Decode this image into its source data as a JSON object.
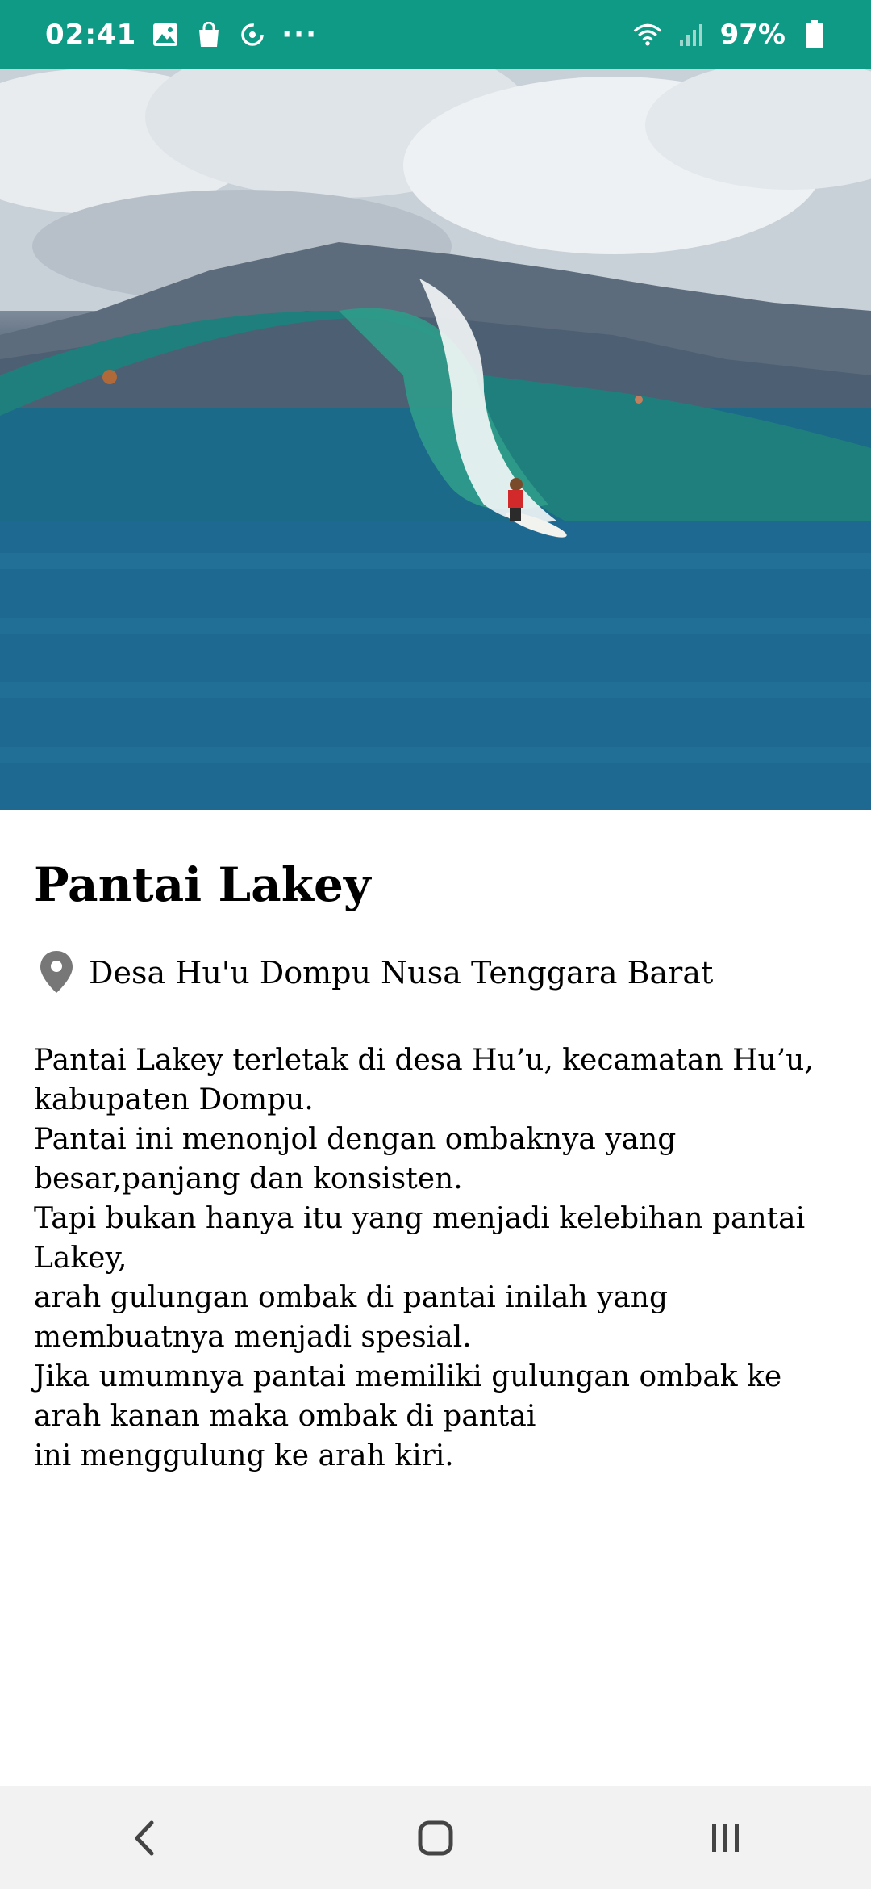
{
  "status_bar": {
    "time": "02:41",
    "overflow": "···",
    "battery_percent": "97%",
    "icons": [
      "gallery-icon",
      "shopping-bag-icon",
      "sync-icon",
      "wifi-icon",
      "signal-icon",
      "battery-icon"
    ]
  },
  "hero_image": {
    "description_icon": "surfer-wave-photo"
  },
  "place": {
    "title": "Pantai Lakey",
    "location": "Desa Hu'u Dompu Nusa Tenggara Barat",
    "description": "Pantai Lakey terletak di desa Hu’u, kecamatan Hu’u, kabupaten Dompu.\n Pantai ini menonjol dengan ombaknya yang besar,panjang dan konsisten.\n Tapi bukan hanya itu yang menjadi kelebihan pantai Lakey,\narah gulungan ombak di pantai inilah yang membuatnya menjadi spesial.\n Jika umumnya pantai memiliki gulungan ombak ke arah kanan maka ombak di pantai\nini menggulung ke arah kiri."
  },
  "navigation": {
    "buttons": [
      "back",
      "home",
      "recents"
    ]
  },
  "colors": {
    "status_bar": "#0f9a86",
    "nav_bar": "#f2f2f2",
    "pin": "#777777"
  }
}
